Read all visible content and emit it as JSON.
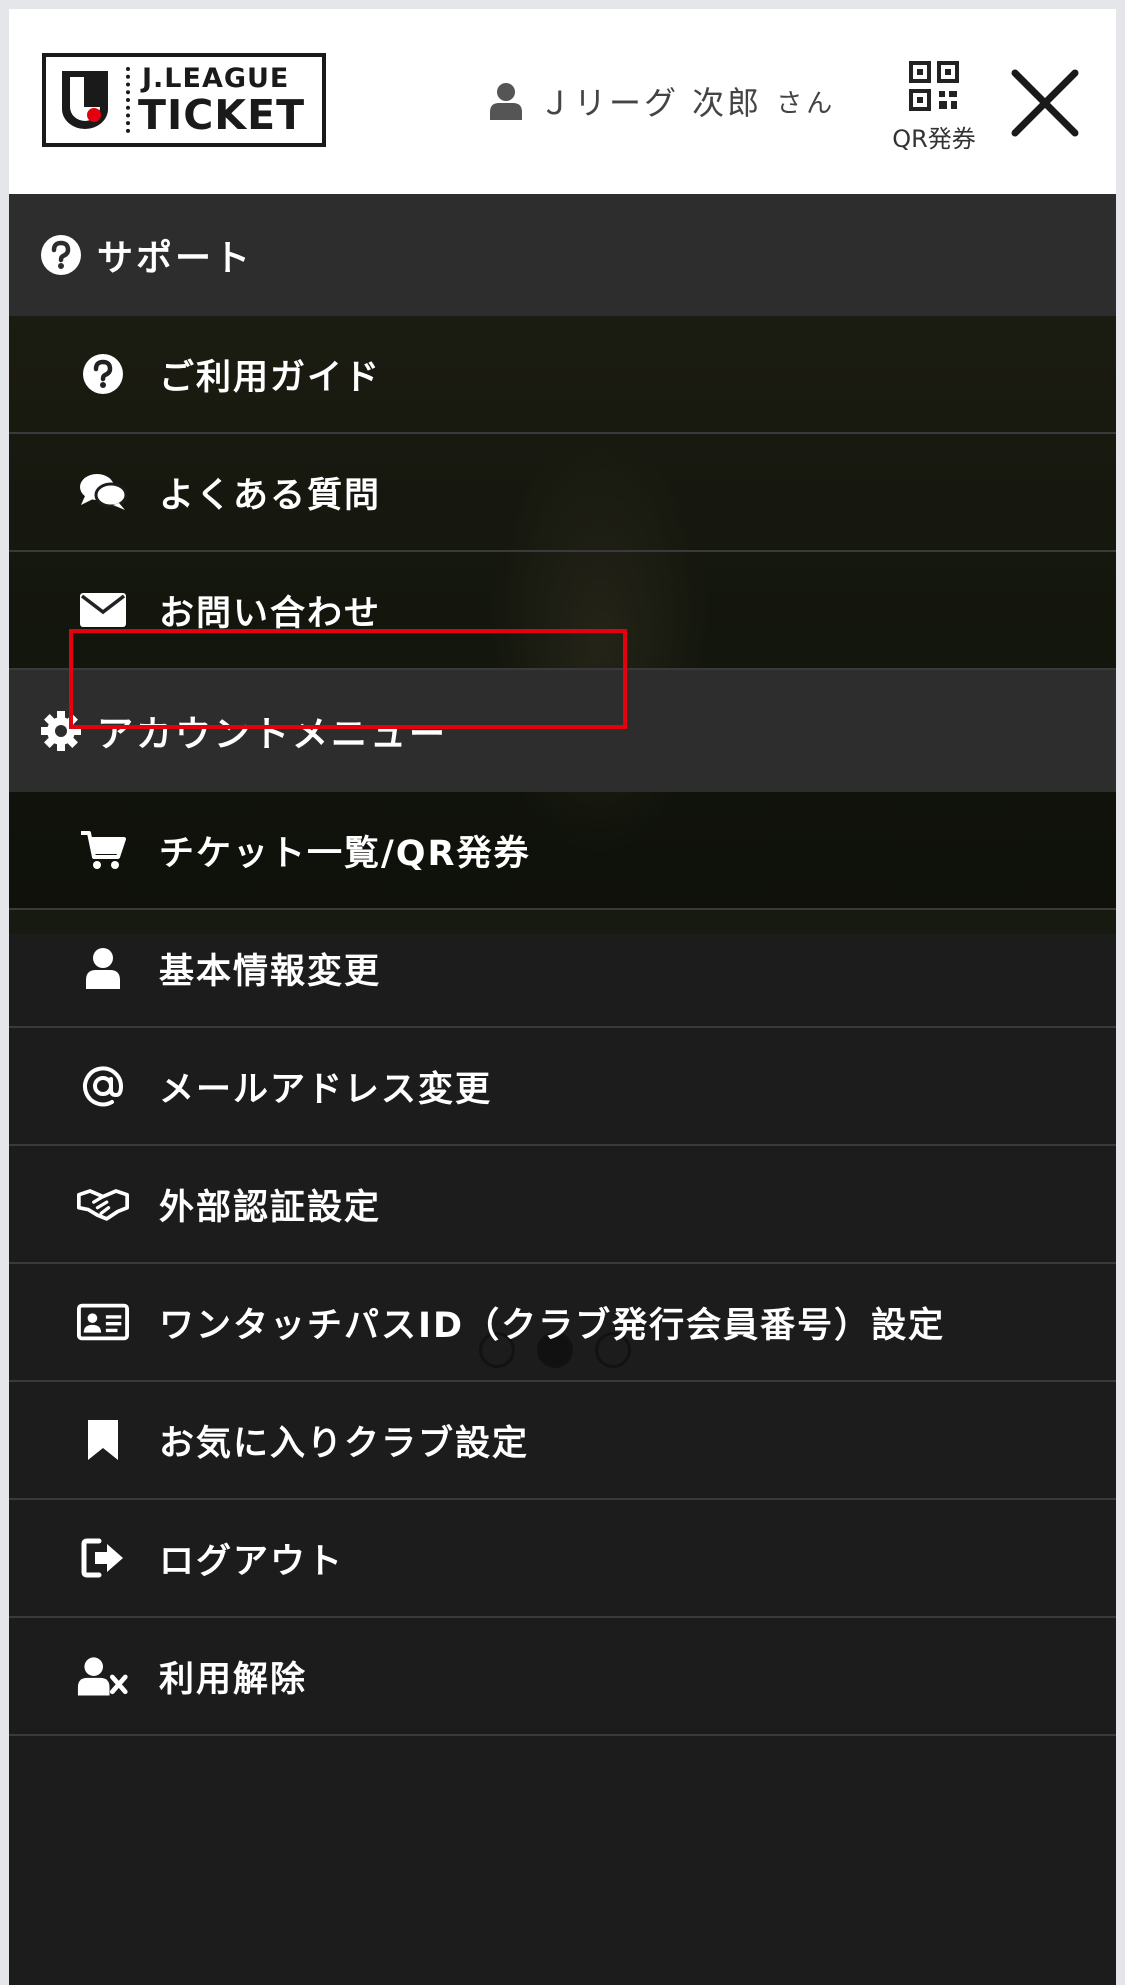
{
  "header": {
    "logo_top": "J.LEAGUE",
    "logo_bottom": "TICKET",
    "user_name": "Ｊリーグ 次郎",
    "user_suffix": "さん",
    "qr_label": "QR発券"
  },
  "sections": [
    {
      "title": "サポート",
      "icon": "question-circle-icon",
      "items": [
        {
          "label": "ご利用ガイド",
          "icon": "question-circle-icon"
        },
        {
          "label": "よくある質問",
          "icon": "chat-bubbles-icon"
        },
        {
          "label": "お問い合わせ",
          "icon": "envelope-icon"
        }
      ]
    },
    {
      "title": "アカウントメニュー",
      "icon": "gear-icon",
      "items": [
        {
          "label": "チケット一覧/QR発券",
          "icon": "cart-icon",
          "highlighted": true
        },
        {
          "label": "基本情報変更",
          "icon": "user-icon"
        },
        {
          "label": "メールアドレス変更",
          "icon": "at-sign-icon"
        },
        {
          "label": "外部認証設定",
          "icon": "handshake-icon"
        },
        {
          "label": "ワンタッチパスID（クラブ発行会員番号）設定",
          "icon": "id-card-icon"
        },
        {
          "label": "お気に入りクラブ設定",
          "icon": "bookmark-icon"
        },
        {
          "label": "ログアウト",
          "icon": "sign-out-icon"
        },
        {
          "label": "利用解除",
          "icon": "user-remove-icon"
        }
      ]
    }
  ],
  "colors": {
    "highlight": "#e3000f",
    "section_bg": "#2d2d2d",
    "menu_bg": "#1c1c1c",
    "header_bg": "#ffffff"
  }
}
